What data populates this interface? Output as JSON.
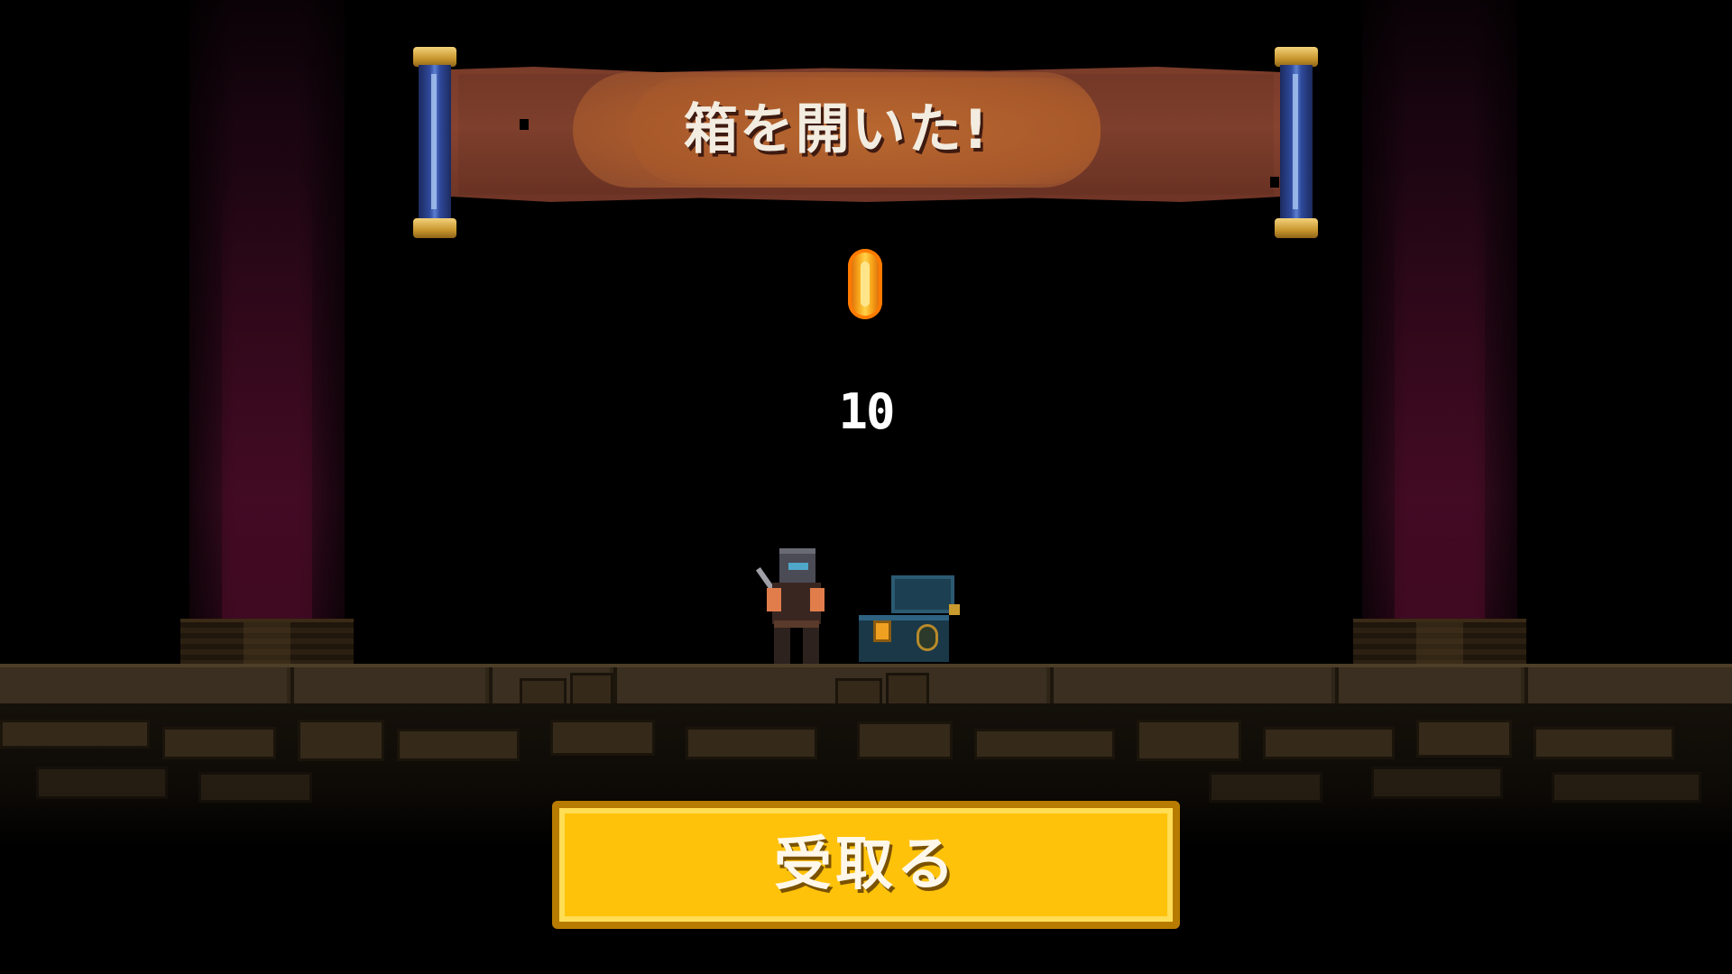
{
  "banner": {
    "title": "箱を開いた!"
  },
  "reward": {
    "item_icon": "gold-coin-icon",
    "count": "10"
  },
  "actions": {
    "receive_label": "受取る"
  },
  "colors": {
    "background": "#000000",
    "banner_scroll": "#86432f",
    "banner_plate": "#a6582c",
    "rod": "#2f4a9c",
    "rod_cap": "#c8962e",
    "coin": "#f7a318",
    "button": "#ffc20a",
    "button_border": "#b77b00",
    "curtain": "#380b20",
    "floor": "#3a2f20"
  }
}
